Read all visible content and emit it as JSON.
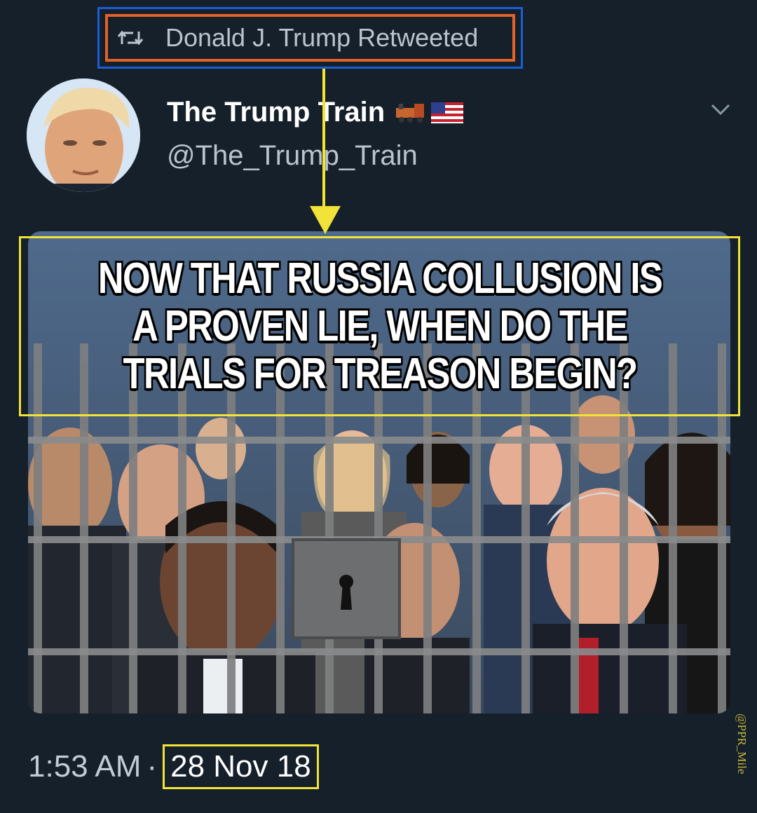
{
  "retweet": {
    "label": "Donald J. Trump Retweeted",
    "icon": "retweet-icon"
  },
  "author": {
    "display_name": "The Trump Train",
    "name_emojis": [
      "locomotive-icon",
      "us-flag-icon"
    ],
    "handle": "@The_Trump_Train",
    "avatar_icon": "avatar"
  },
  "menu": {
    "icon": "chevron-down-icon"
  },
  "media": {
    "headline": "NOW THAT RUSSIA COLLUSION IS A PROVEN LIE, WHEN DO THE TRIALS FOR TREASON BEGIN?"
  },
  "timestamp": {
    "time": "1:53 AM",
    "separator": "·",
    "date": "28 Nov 18"
  },
  "watermark": "@PPR_Mile",
  "colors": {
    "background": "#15202b",
    "highlight_yellow": "#f1e338",
    "highlight_orange": "#e2622a",
    "highlight_blue": "#1a5fd6",
    "secondary_text": "#b9c4ce"
  }
}
